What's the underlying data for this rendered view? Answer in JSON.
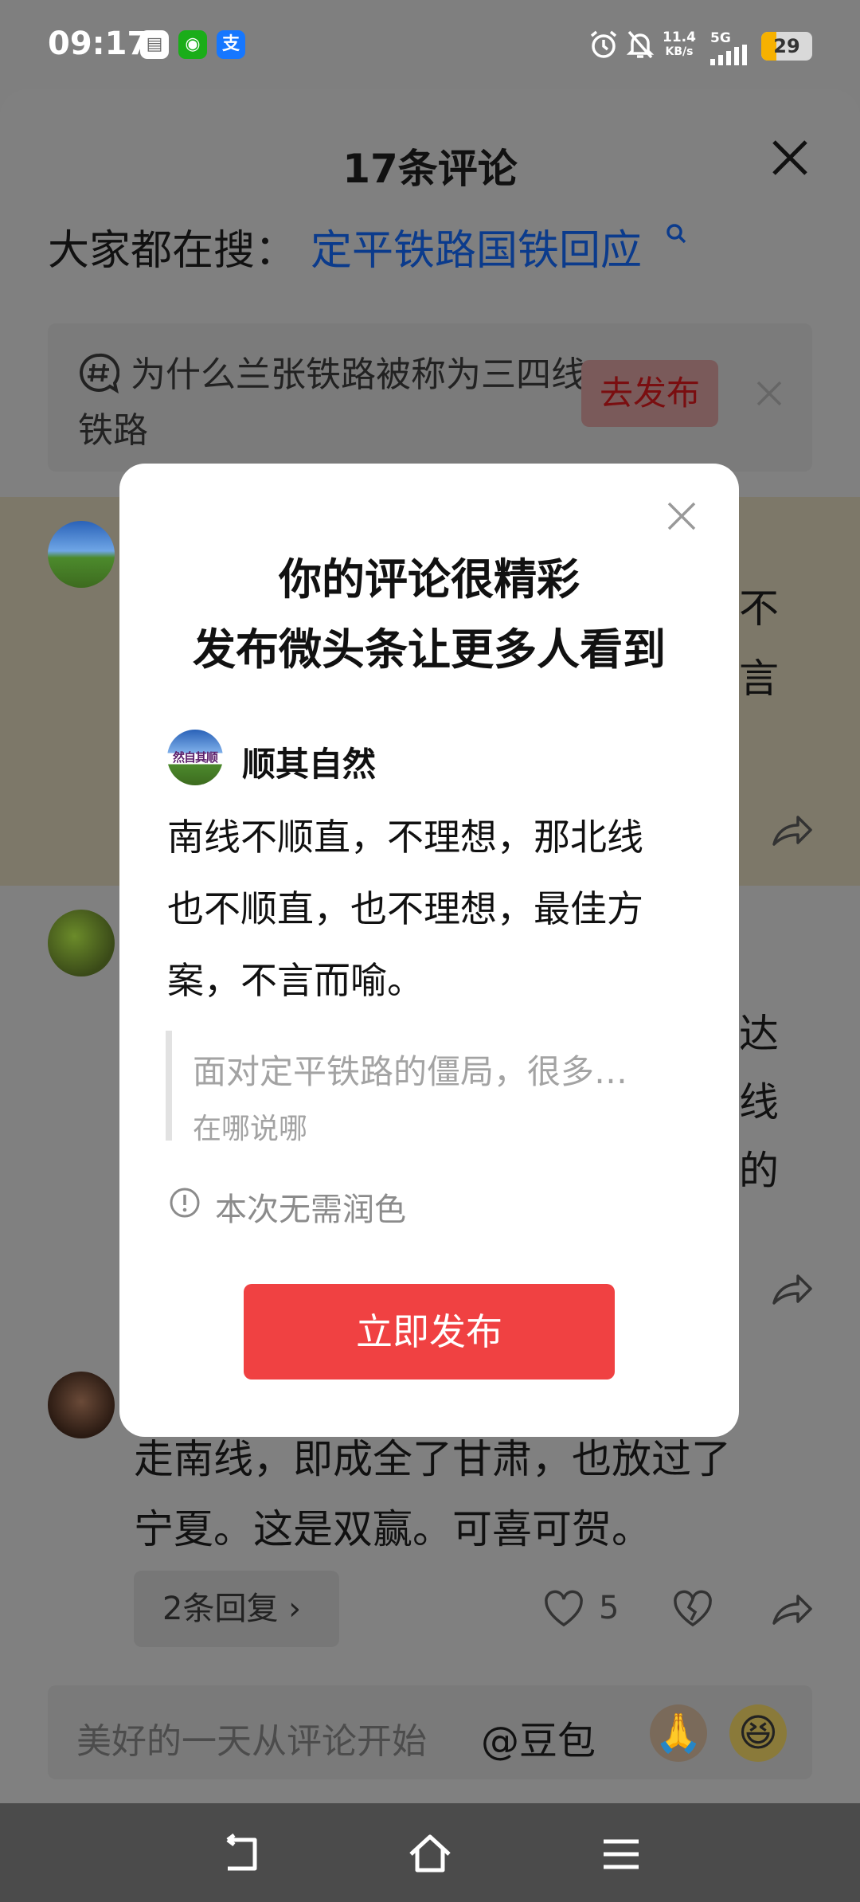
{
  "status_bar": {
    "time": "09:17",
    "apps": [
      {
        "name": "notes-app-icon",
        "color": "#ffffff"
      },
      {
        "name": "wechat-icon",
        "color": "#1aad19"
      },
      {
        "name": "alipay-icon",
        "color": "#1677ff"
      }
    ],
    "speed_value": "11.4",
    "speed_unit": "KB/s",
    "network": "5G",
    "battery_level": "29",
    "battery_fraction": 0.29
  },
  "sheet": {
    "title": "17条评论",
    "hot_search_label": "大家都在搜：",
    "hot_search_link": "定平铁路国铁回应",
    "topic": {
      "text": "为什么兰张铁路被称为三四线铁路",
      "button": "去发布"
    },
    "bg_comment_fragments": [
      "不",
      "言",
      "达",
      "线",
      "的"
    ],
    "third_comment": {
      "text_line1": "走南线，即成全了甘肃，也放过了",
      "text_line2": "宁夏。这是双赢。可喜可贺。",
      "replies": "2条回复",
      "likes": "5"
    },
    "comment_input": {
      "placeholder": "美好的一天从评论开始",
      "mention": "@豆包"
    }
  },
  "modal": {
    "title_line1": "你的评论很精彩",
    "title_line2": "发布微头条让更多人看到",
    "author": "顺其自然",
    "avatar_text": "然自其顺",
    "body": "南线不顺直，不理想，那北线也不顺直，也不理想，最佳方案，不言而喻。",
    "quote_text": "面对定平铁路的僵局，很多…",
    "quote_source": "在哪说哪",
    "info": "本次无需润色",
    "publish_button": "立即发布"
  },
  "colors": {
    "accent_red": "#f04142",
    "link_blue": "#0b3b8c",
    "battery_yellow": "#f6b100"
  }
}
